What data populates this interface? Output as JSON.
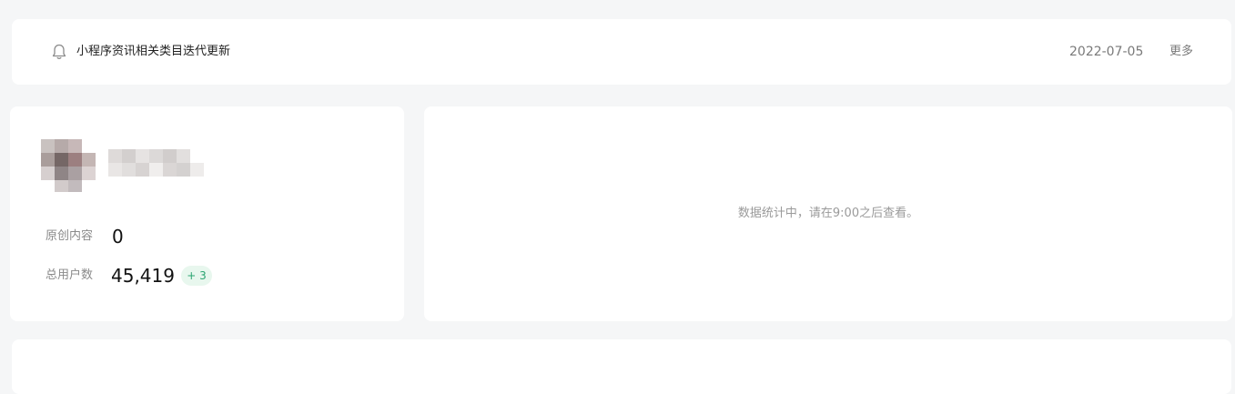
{
  "notice": {
    "icon": "bell-icon",
    "title": "小程序资讯相关类目迭代更新",
    "date": "2022-07-05",
    "more_label": "更多"
  },
  "profile": {
    "stats": [
      {
        "label": "原创内容",
        "value": "0"
      },
      {
        "label": "总用户数",
        "value": "45,419",
        "badge": "+ 3"
      }
    ]
  },
  "stats_panel": {
    "message": "数据统计中，请在9:00之后查看。"
  },
  "colors": {
    "page_bg": "#f5f6f7",
    "card_bg": "#ffffff",
    "badge_bg": "#e8f7ee",
    "badge_text": "#2ba471"
  }
}
